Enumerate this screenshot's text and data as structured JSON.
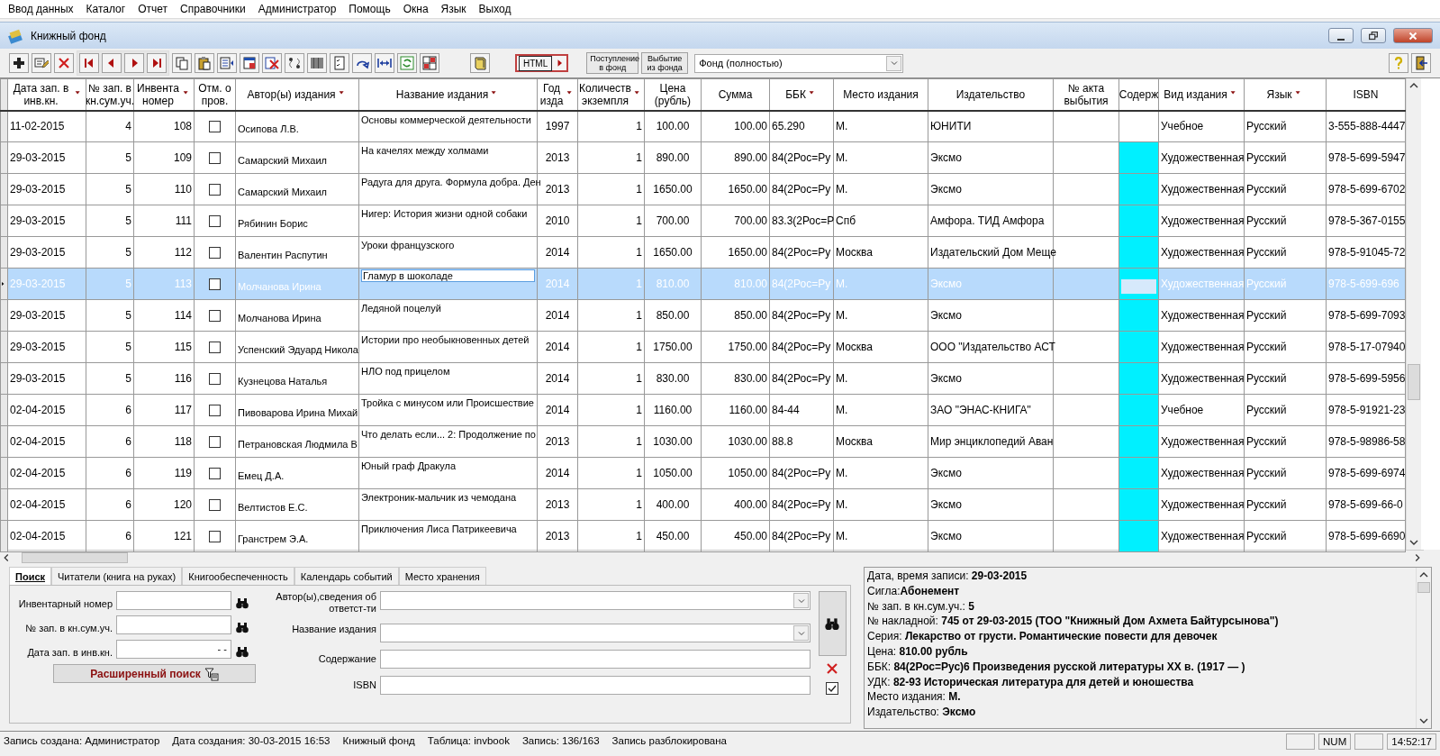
{
  "menu": [
    "Ввод данных",
    "Каталог",
    "Отчет",
    "Справочники",
    "Администратор",
    "Помощь",
    "Окна",
    "Язык",
    "Выход"
  ],
  "window": {
    "title": "Книжный фонд"
  },
  "toolbar": {
    "html_button": "HTML",
    "income_button": "Поступление в фонд",
    "disposal_button": "Выбытие из фонда",
    "fund_select": "Фонд (полностью)"
  },
  "table": {
    "columns": [
      {
        "label": "Дата зап. в инв.кн.",
        "kind": "text",
        "sortable": true
      },
      {
        "label": "№ зап. в кн.сум.уч.",
        "kind": "number",
        "sortable": false
      },
      {
        "label": "Инвента номер",
        "kind": "number",
        "sortable": true
      },
      {
        "label": "Отм. о пров.",
        "kind": "check",
        "sortable": false
      },
      {
        "label": "Автор(ы) издания",
        "kind": "author",
        "sortable": true
      },
      {
        "label": "Название издания",
        "kind": "title",
        "sortable": true
      },
      {
        "label": "Год изда",
        "kind": "center",
        "sortable": true
      },
      {
        "label": "Количеств экземпля",
        "kind": "number",
        "sortable": true
      },
      {
        "label": "Цена (рубль)",
        "kind": "center",
        "sortable": false
      },
      {
        "label": "Сумма",
        "kind": "number",
        "sortable": false
      },
      {
        "label": "ББК",
        "kind": "text",
        "sortable": true
      },
      {
        "label": "Место издания",
        "kind": "text",
        "sortable": false
      },
      {
        "label": "Издательство",
        "kind": "text",
        "sortable": false
      },
      {
        "label": "№ акта выбытия",
        "kind": "empty",
        "sortable": false
      },
      {
        "label": "Содерж",
        "kind": "fill",
        "sortable": false
      },
      {
        "label": "Вид издания",
        "kind": "text",
        "sortable": true
      },
      {
        "label": "Язык",
        "kind": "text",
        "sortable": true
      },
      {
        "label": "ISBN",
        "kind": "text",
        "sortable": false
      }
    ],
    "rows": [
      {
        "selected": false,
        "checked": false,
        "has_content": false,
        "cells": [
          "11-02-2015",
          "4",
          "108",
          "",
          "Осипова Л.В.",
          "Основы коммерческой деятельности",
          "1997",
          "1",
          "100.00",
          "100.00",
          "65.290",
          "М.",
          "ЮНИТИ",
          "",
          "",
          "Учебное",
          "Русский",
          "3-555-888-4447"
        ]
      },
      {
        "selected": false,
        "checked": false,
        "has_content": true,
        "cells": [
          "29-03-2015",
          "5",
          "109",
          "",
          "Самарский Михаил",
          "На качелях между холмами",
          "2013",
          "1",
          "890.00",
          "890.00",
          "84(2Рос=Ру",
          "М.",
          "Эксмо",
          "",
          "",
          "Художественная",
          "Русский",
          "978-5-699-5947"
        ]
      },
      {
        "selected": false,
        "checked": false,
        "has_content": true,
        "cells": [
          "29-03-2015",
          "5",
          "110",
          "",
          "Самарский Михаил",
          "Радуга для друга. Формула добра. Ден",
          "2013",
          "1",
          "1650.00",
          "1650.00",
          "84(2Рос=Ру",
          "М.",
          "Эксмо",
          "",
          "",
          "Художественная",
          "Русский",
          "978-5-699-6702"
        ]
      },
      {
        "selected": false,
        "checked": false,
        "has_content": true,
        "cells": [
          "29-03-2015",
          "5",
          "111",
          "",
          "Рябинин Борис",
          "Нигер: История жизни одной собаки",
          "2010",
          "1",
          "700.00",
          "700.00",
          "83.3(2Рос=Р",
          "Спб",
          "Амфора. ТИД Амфора",
          "",
          "",
          "Художественная",
          "Русский",
          "978-5-367-0155"
        ]
      },
      {
        "selected": false,
        "checked": false,
        "has_content": true,
        "cells": [
          "29-03-2015",
          "5",
          "112",
          "",
          "Валентин Распутин",
          "Уроки французского",
          "2014",
          "1",
          "1650.00",
          "1650.00",
          "84(2Рос=Ру",
          "Москва",
          "Издательский Дом Меще",
          "",
          "",
          "Художественная",
          "Русский",
          "978-5-91045-72"
        ]
      },
      {
        "selected": true,
        "checked": false,
        "has_content": true,
        "cells": [
          "29-03-2015",
          "5",
          "113",
          "",
          "Молчанова Ирина",
          "Гламур в шоколаде",
          "2014",
          "1",
          "810.00",
          "810.00",
          "84(2Рос=Ру",
          "М.",
          "Эксмо",
          "",
          "",
          "Художественная",
          "Русский",
          "978-5-699-696"
        ]
      },
      {
        "selected": false,
        "checked": false,
        "has_content": true,
        "cells": [
          "29-03-2015",
          "5",
          "114",
          "",
          "Молчанова Ирина",
          "Ледяной поцелуй",
          "2014",
          "1",
          "850.00",
          "850.00",
          "84(2Рос=Ру",
          "М.",
          "Эксмо",
          "",
          "",
          "Художественная",
          "Русский",
          "978-5-699-7093"
        ]
      },
      {
        "selected": false,
        "checked": false,
        "has_content": true,
        "cells": [
          "29-03-2015",
          "5",
          "115",
          "",
          "Успенский Эдуард Никола",
          "Истории про необыкновенных детей",
          "2014",
          "1",
          "1750.00",
          "1750.00",
          "84(2Рос=Ру",
          "Москва",
          "ООО \"Издательство АСТ",
          "",
          "",
          "Художественная",
          "Русский",
          "978-5-17-07940"
        ]
      },
      {
        "selected": false,
        "checked": false,
        "has_content": true,
        "cells": [
          "29-03-2015",
          "5",
          "116",
          "",
          "Кузнецова Наталья",
          "НЛО под прицелом",
          "2014",
          "1",
          "830.00",
          "830.00",
          "84(2Рос=Ру",
          "М.",
          "Эксмо",
          "",
          "",
          "Художественная",
          "Русский",
          "978-5-699-5956"
        ]
      },
      {
        "selected": false,
        "checked": false,
        "has_content": true,
        "cells": [
          "02-04-2015",
          "6",
          "117",
          "",
          "Пивоварова Ирина Михай",
          "Тройка с минусом или Происшествие",
          "2014",
          "1",
          "1160.00",
          "1160.00",
          "84-44",
          "М.",
          "ЗАО \"ЭНАС-КНИГА\"",
          "",
          "",
          "Учебное",
          "Русский",
          "978-5-91921-23"
        ]
      },
      {
        "selected": false,
        "checked": false,
        "has_content": true,
        "cells": [
          "02-04-2015",
          "6",
          "118",
          "",
          "Петрановская Людмила В",
          "Что делать если... 2: Продолжение по",
          "2013",
          "1",
          "1030.00",
          "1030.00",
          "88.8",
          "Москва",
          "Мир энциклопедий Аван",
          "",
          "",
          "Художественная",
          "Русский",
          "978-5-98986-58"
        ]
      },
      {
        "selected": false,
        "checked": false,
        "has_content": true,
        "cells": [
          "02-04-2015",
          "6",
          "119",
          "",
          "Емец Д.А.",
          "Юный граф Дракула",
          "2014",
          "1",
          "1050.00",
          "1050.00",
          "84(2Рос=Ру",
          "М.",
          "Эксмо",
          "",
          "",
          "Художественная",
          "Русский",
          "978-5-699-6974"
        ]
      },
      {
        "selected": false,
        "checked": false,
        "has_content": true,
        "cells": [
          "02-04-2015",
          "6",
          "120",
          "",
          "Велтистов Е.С.",
          "Электроник-мальчик из чемодана",
          "2013",
          "1",
          "400.00",
          "400.00",
          "84(2Рос=Ру",
          "М.",
          "Эксмо",
          "",
          "",
          "Художественная",
          "Русский",
          "978-5-699-66-0"
        ]
      },
      {
        "selected": false,
        "checked": false,
        "has_content": true,
        "cells": [
          "02-04-2015",
          "6",
          "121",
          "",
          "Гранстрем Э.А.",
          "Приключения Лиса Патрикеевича",
          "2013",
          "1",
          "450.00",
          "450.00",
          "84(2Рос=Ру",
          "М.",
          "Эксмо",
          "",
          "",
          "Художественная",
          "Русский",
          "978-5-699-6690"
        ]
      }
    ]
  },
  "bottom_tabs": [
    {
      "label": "Поиск",
      "selected": true
    },
    {
      "label": "Читатели (книга на руках)",
      "selected": false
    },
    {
      "label": "Книгообеспеченность",
      "selected": false
    },
    {
      "label": "Календарь событий",
      "selected": false
    },
    {
      "label": "Место хранения",
      "selected": false
    }
  ],
  "search": {
    "left_fields": [
      {
        "label": "Инвентарный номер"
      },
      {
        "label": "№ зап. в кн.сум.уч."
      },
      {
        "label": "Дата зап. в инв.кн.",
        "value": "- -"
      }
    ],
    "advanced_button": "Расширенный поиск",
    "right_fields": [
      {
        "label": "Автор(ы),сведения об ответст-ти",
        "kind": "combo"
      },
      {
        "label": "Название издания",
        "kind": "combo"
      },
      {
        "label": "Содержание",
        "kind": "text"
      },
      {
        "label": "ISBN",
        "kind": "text"
      }
    ],
    "filter_checked": true
  },
  "details": [
    "Дата, время записи: **29-03-2015**",
    "Сигла:**Абонемент**",
    "№ зап. в кн.сум.уч.: **5**",
    "№ накладной: **745 от 29-03-2015 (ТОО \"Книжный Дом Ахмета Байтурсынова\")**",
    "Серия: **Лекарство от грусти. Романтические повести для девочек**",
    "Цена: **810.00 рубль**",
    "ББК: **84(2Рос=Рус)6 Произведения русской литературы XX в. (1917 — )**",
    "УДК: **82-93 Историческая литература для детей и юношества**",
    "Место издания: **М.**",
    "Издательство: **Эксмо**"
  ],
  "status_bar": [
    "Запись создана: Администратор",
    "Дата создания: 30-03-2015 16:53",
    "Книжный фонд",
    "Таблица: invbook",
    "Запись: 136/163",
    "Запись разблокирована"
  ],
  "status_indicators": [
    "NUM",
    "14:52:17"
  ]
}
